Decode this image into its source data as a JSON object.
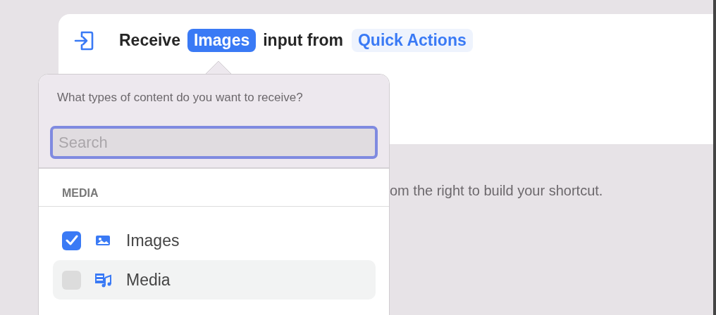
{
  "action": {
    "verb": "Receive",
    "content_type": "Images",
    "connector": "input from",
    "source": "Quick Actions"
  },
  "hint": "om the right to build your shortcut.",
  "popover": {
    "question": "What types of content do you want to receive?",
    "search": {
      "placeholder": "Search"
    },
    "section": "MEDIA",
    "items": [
      {
        "label": "Images",
        "checked": true,
        "highlighted": false
      },
      {
        "label": "Media",
        "checked": false,
        "highlighted": true
      }
    ]
  }
}
